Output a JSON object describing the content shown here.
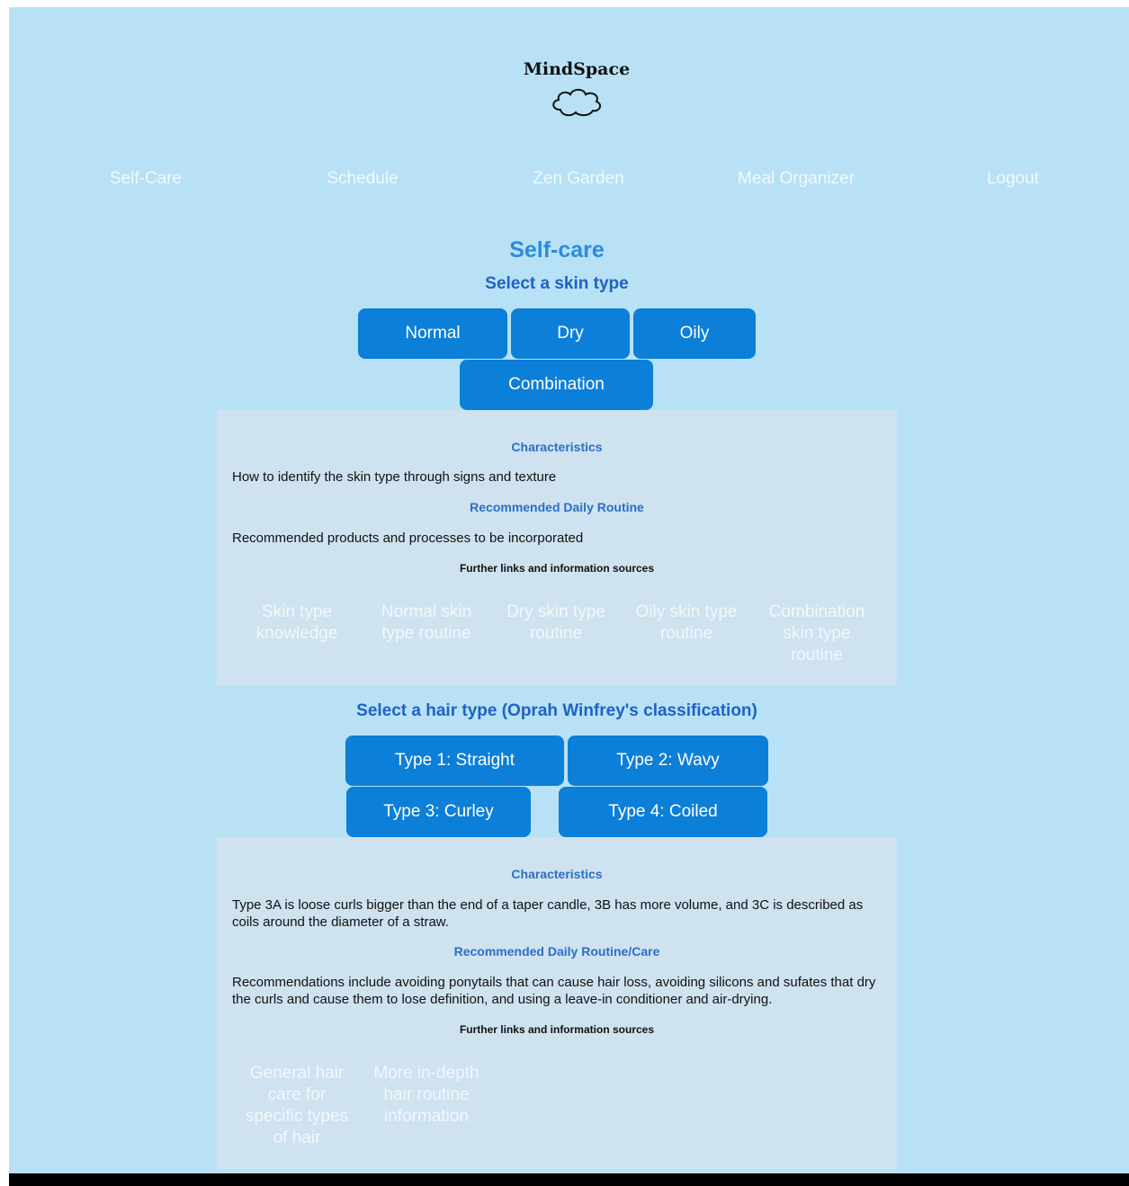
{
  "brand": {
    "name": "MindSpace",
    "icon": "cloud-icon"
  },
  "nav": [
    {
      "label": "Self-Care"
    },
    {
      "label": "Schedule"
    },
    {
      "label": "Zen Garden"
    },
    {
      "label": "Meal Organizer"
    },
    {
      "label": "Logout"
    }
  ],
  "page_title": "Self-care",
  "skin": {
    "heading": "Select a skin type",
    "buttons": [
      "Normal",
      "Dry",
      "Oily",
      "Combination"
    ],
    "characteristics_heading": "Characteristics",
    "characteristics_text": "How to identify the skin type through signs and texture",
    "routine_heading": "Recommended Daily Routine",
    "routine_text": "Recommended products and processes to be incorporated",
    "links_heading": "Further links and information sources",
    "links": [
      "Skin type knowledge",
      "Normal skin type routine",
      "Dry skin type routine",
      "Oily skin type routine",
      "Combination skin type routine"
    ]
  },
  "hair": {
    "heading": "Select a hair type (Oprah Winfrey's classification)",
    "buttons": [
      "Type 1: Straight",
      "Type 2: Wavy",
      "Type 3: Curley",
      "Type 4: Coiled"
    ],
    "characteristics_heading": "Characteristics",
    "characteristics_text": "Type 3A is loose curls bigger than the end of a taper candle, 3B has more volume, and 3C is described as coils around the diameter of a straw.",
    "routine_heading": "Recommended Daily Routine/Care",
    "routine_text": "Recommendations include avoiding ponytails that can cause hair loss, avoiding silicons and sufates that dry the curls and cause them to lose definition, and using a leave-in conditioner and air-drying.",
    "links_heading": "Further links and information sources",
    "links": [
      "General hair care for specific types of hair",
      "More in-depth hair routine information"
    ]
  }
}
